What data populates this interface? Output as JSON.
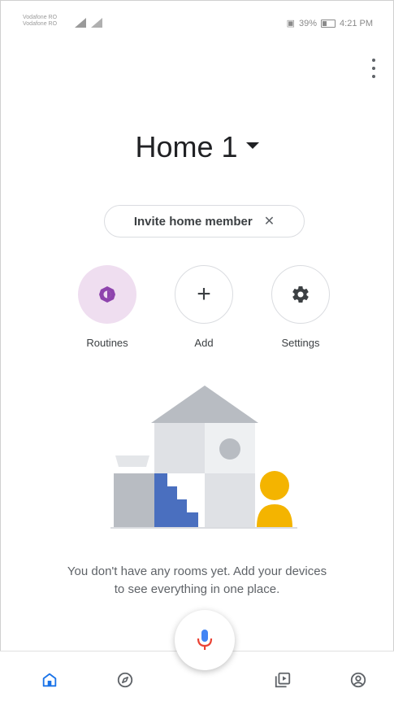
{
  "status_bar": {
    "carrier_line1": "Vodafone RO",
    "carrier_line2": "Vodafone RO",
    "battery_percent": "39%",
    "time": "4:21 PM"
  },
  "header": {
    "home_name": "Home 1"
  },
  "chip": {
    "label": "Invite home member",
    "close_glyph": "✕"
  },
  "actions": [
    {
      "label": "Routines",
      "icon": "routines-icon"
    },
    {
      "label": "Add",
      "icon": "plus-icon",
      "glyph": "+"
    },
    {
      "label": "Settings",
      "icon": "gear-icon"
    }
  ],
  "empty_state": {
    "line1": "You don't have any rooms yet. Add your devices",
    "line2": "to see everything in one place."
  },
  "bottom_nav": {
    "items": [
      {
        "icon": "home-icon",
        "active": true
      },
      {
        "icon": "compass-icon",
        "active": false
      },
      {
        "icon": "media-icon",
        "active": false
      },
      {
        "icon": "account-icon",
        "active": false
      }
    ]
  },
  "colors": {
    "accent_blue": "#1a73e8",
    "routines_bg": "#efdef0",
    "routines_icon": "#8e44ad",
    "mic_red": "#ea4335",
    "mic_blue": "#4285f4"
  }
}
